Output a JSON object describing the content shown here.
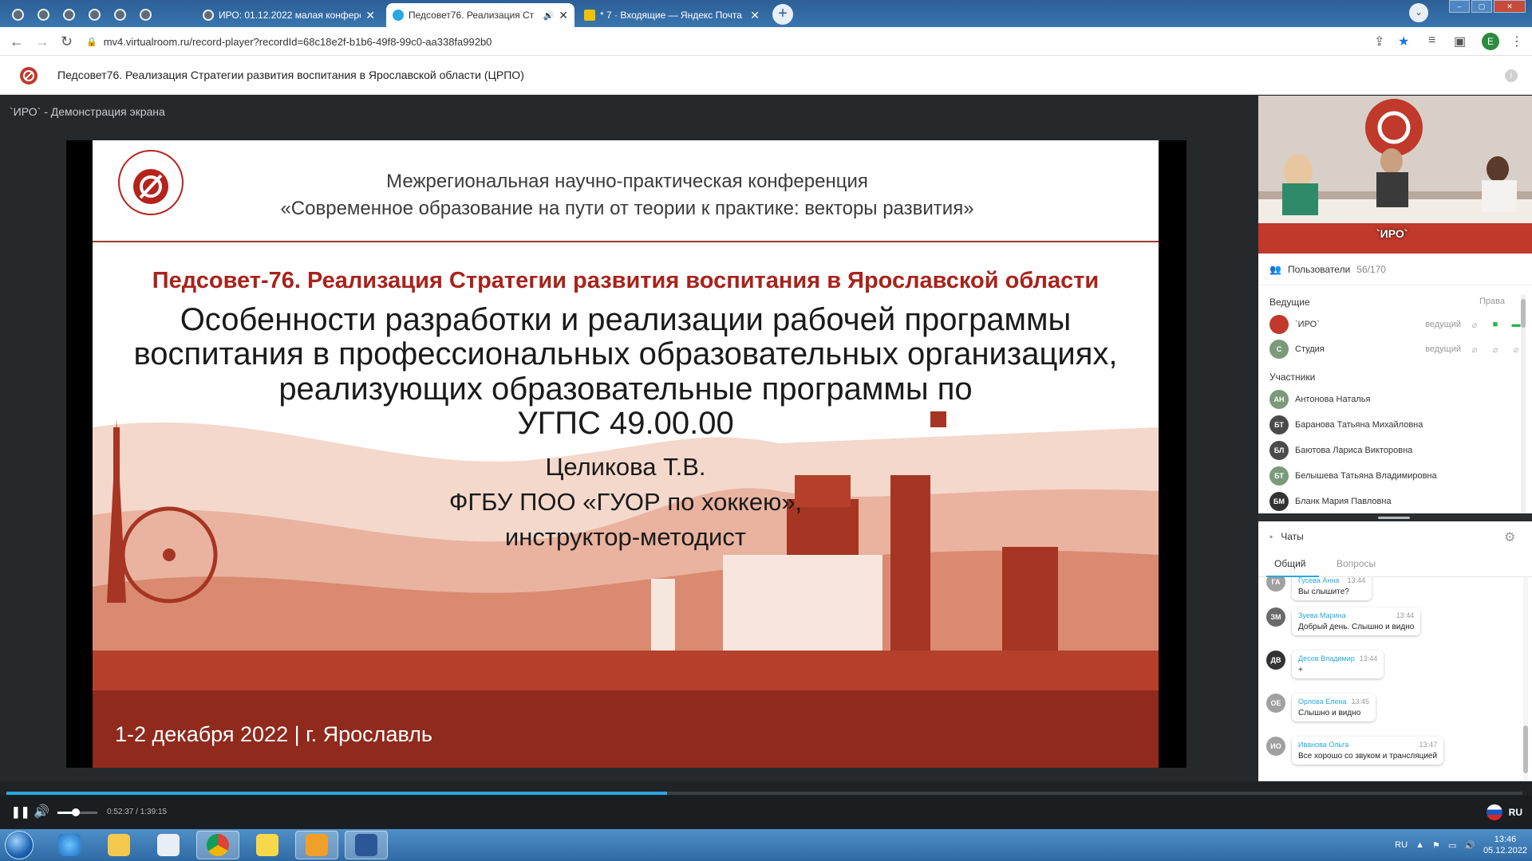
{
  "browser": {
    "tabs": [
      {
        "label": "ИРО: 01.12.2022 малая конфере",
        "active": false
      },
      {
        "label": "Педсовет76. Реализация Ст",
        "active": true
      },
      {
        "label": "* 7 · Входящие — Яндекс Почта",
        "active": false
      }
    ],
    "url": "mv4.virtualroom.ru/record-player?recordId=68c18e2f-b1b6-49f8-99c0-aa338fa992b0",
    "profile_initial": "E"
  },
  "page": {
    "title": "Педсовет76. Реализация Стратегии развития воспитания в Ярославской области (ЦРПО)"
  },
  "share": {
    "label": "`ИРО` - Демонстрация экрана"
  },
  "slide": {
    "conf_line1": "Межрегиональная научно-практическая конференция",
    "conf_line2": "«Современное образование на пути от теории к практике: векторы развития»",
    "subtitle": "Педсовет-76. Реализация Стратегии развития воспитания в Ярославской области",
    "title_lines": [
      "Особенности разработки и реализации рабочей программы",
      "воспитания в профессиональных образовательных организациях,",
      "реализующих образовательные программы по",
      "УГПС 49.00.00"
    ],
    "author": "Целикова Т.В.",
    "org": "ФГБУ ПОО «ГУОР по хоккею»,",
    "position": "инструктор-методист",
    "date_place": "1-2 декабря 2022  | г. Ярославль"
  },
  "player": {
    "time": "0:52:37 / 1:39:15",
    "progress": 0.436,
    "volume": 0.45,
    "lang": "RU"
  },
  "camera": {
    "label": "`ИРО`"
  },
  "users": {
    "title": "Пользователи",
    "count": "56/170",
    "hosts_label": "Ведущие",
    "rights_label": "Права",
    "hosts": [
      {
        "initials": "",
        "name": "`ИРО`",
        "role": "ведущий",
        "color": "#c0392b"
      },
      {
        "initials": "С",
        "name": "Студия",
        "role": "ведущий",
        "color": "#7a9a7a"
      }
    ],
    "participants_label": "Участники",
    "participants": [
      {
        "initials": "АН",
        "name": "Антонова Наталья",
        "color": "#7a9a7a"
      },
      {
        "initials": "БТ",
        "name": "Баранова Татьяна Михайловна",
        "color": "#4a4a4a"
      },
      {
        "initials": "БЛ",
        "name": "Баютова Лариса Викторовна",
        "color": "#4a4a4a"
      },
      {
        "initials": "БТ",
        "name": "Белышева Татьяна Владимировна",
        "color": "#7a9a7a"
      },
      {
        "initials": "БМ",
        "name": "Бланк Мария Павловна",
        "color": "#333333"
      }
    ]
  },
  "chats": {
    "title": "Чаты",
    "tabs": [
      "Общий",
      "Вопросы"
    ],
    "messages": [
      {
        "initials": "ГА",
        "name": "Гусева Анна",
        "time": "13:44",
        "text": "Вы слышите?",
        "color": "#a0a0a0"
      },
      {
        "initials": "ЗМ",
        "name": "Зуева Марина",
        "time": "13:44",
        "text": "Добрый день. Слышно и видно",
        "color": "#6a6a6a"
      },
      {
        "initials": "ДВ",
        "name": "Десов Владимир",
        "time": "13:44",
        "text": "+",
        "color": "#333333"
      },
      {
        "initials": "ОЕ",
        "name": "Орлова Елена",
        "time": "13:45",
        "text": "Слышно и видно",
        "color": "#a0a0a0"
      },
      {
        "initials": "ИО",
        "name": "Иванова Ольга",
        "time": "13:47",
        "text": "Все хорошо со звуком и трансляцией",
        "color": "#a0a0a0"
      }
    ]
  },
  "taskbar": {
    "lang": "RU",
    "time": "13:46",
    "date": "05.12.2022"
  }
}
